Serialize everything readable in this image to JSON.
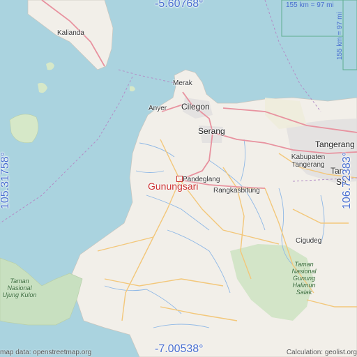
{
  "coordinates": {
    "lat_top": "-5.60768°",
    "lat_bottom": "-7.00538°",
    "lon_left": "105.31758°",
    "lon_right": "106.72383°"
  },
  "scale": {
    "horizontal": "155 km = 97 mi",
    "vertical": "155 km = 97 mi"
  },
  "attribution": {
    "left": "map data: openstreetmap.org",
    "right": "Calculation: geolist.org"
  },
  "main_place": "Gunungsari",
  "places": [
    "Kalianda",
    "Merak",
    "Anyer",
    "Cilegon",
    "Serang",
    "Tangerang",
    "Kabupaten Tangerang",
    "Tan",
    "Se",
    "Pandeglang",
    "Rangkasbitung",
    "Cigudeg"
  ],
  "parks": {
    "ujung_kulon": "Taman Nasional Ujung Kulon",
    "halimun": "Taman Nasional Gunung Halimun Salak"
  },
  "colors": {
    "water": "#aad3df",
    "land": "#f2efe9",
    "park": "#c8e0c0",
    "primary_road": "#e8929f",
    "secondary_road": "#f3c77a",
    "river": "#8fb8e6",
    "urban": "#e0dfdf",
    "accent": "#4a6fd0",
    "marker": "#cc3333"
  }
}
